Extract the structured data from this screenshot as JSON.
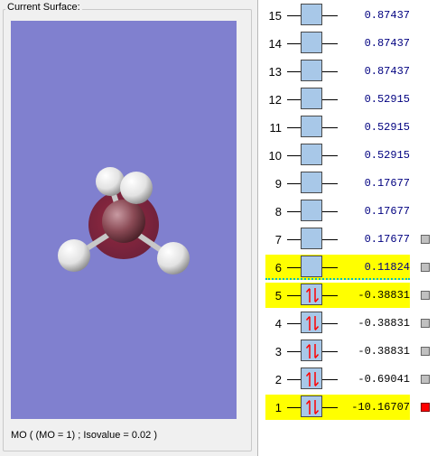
{
  "panel": {
    "title": "Current Surface:",
    "caption": "MO ( (MO = 1) ; Isovalue = 0.02 )"
  },
  "orbitals": [
    {
      "n": "15",
      "energy": "0.87437",
      "occupied": false,
      "highlighted": false,
      "marker": "none"
    },
    {
      "n": "14",
      "energy": "0.87437",
      "occupied": false,
      "highlighted": false,
      "marker": "none"
    },
    {
      "n": "13",
      "energy": "0.87437",
      "occupied": false,
      "highlighted": false,
      "marker": "none"
    },
    {
      "n": "12",
      "energy": "0.52915",
      "occupied": false,
      "highlighted": false,
      "marker": "none"
    },
    {
      "n": "11",
      "energy": "0.52915",
      "occupied": false,
      "highlighted": false,
      "marker": "none"
    },
    {
      "n": "10",
      "energy": "0.52915",
      "occupied": false,
      "highlighted": false,
      "marker": "none"
    },
    {
      "n": "9",
      "energy": "0.17677",
      "occupied": false,
      "highlighted": false,
      "marker": "none"
    },
    {
      "n": "8",
      "energy": "0.17677",
      "occupied": false,
      "highlighted": false,
      "marker": "none"
    },
    {
      "n": "7",
      "energy": "0.17677",
      "occupied": false,
      "highlighted": false,
      "marker": "gray"
    },
    {
      "n": "6",
      "energy": "0.11824",
      "occupied": false,
      "highlighted": true,
      "marker": "gray"
    },
    {
      "n": "5",
      "energy": "-0.38831",
      "occupied": true,
      "highlighted": true,
      "marker": "gray"
    },
    {
      "n": "4",
      "energy": "-0.38831",
      "occupied": true,
      "highlighted": false,
      "marker": "gray"
    },
    {
      "n": "3",
      "energy": "-0.38831",
      "occupied": true,
      "highlighted": false,
      "marker": "gray"
    },
    {
      "n": "2",
      "energy": "-0.69041",
      "occupied": true,
      "highlighted": false,
      "marker": "gray"
    },
    {
      "n": "1",
      "energy": "-10.16707",
      "occupied": true,
      "highlighted": true,
      "marker": "red"
    }
  ],
  "colors": {
    "viewport_bg": "#8080cf",
    "highlight": "#ffff00",
    "orbital_box": "#a8c8e8",
    "energy_virtual": "#000080",
    "energy_occupied": "#000000",
    "electron_arrow": "#ff0000",
    "homo_lumo_line": "#00c0c0",
    "marker_red": "#ff0000",
    "marker_gray": "#c0c0c0"
  },
  "icons": {
    "electron_pair": "up-down-arrow-pair",
    "surface_marker": "square"
  }
}
